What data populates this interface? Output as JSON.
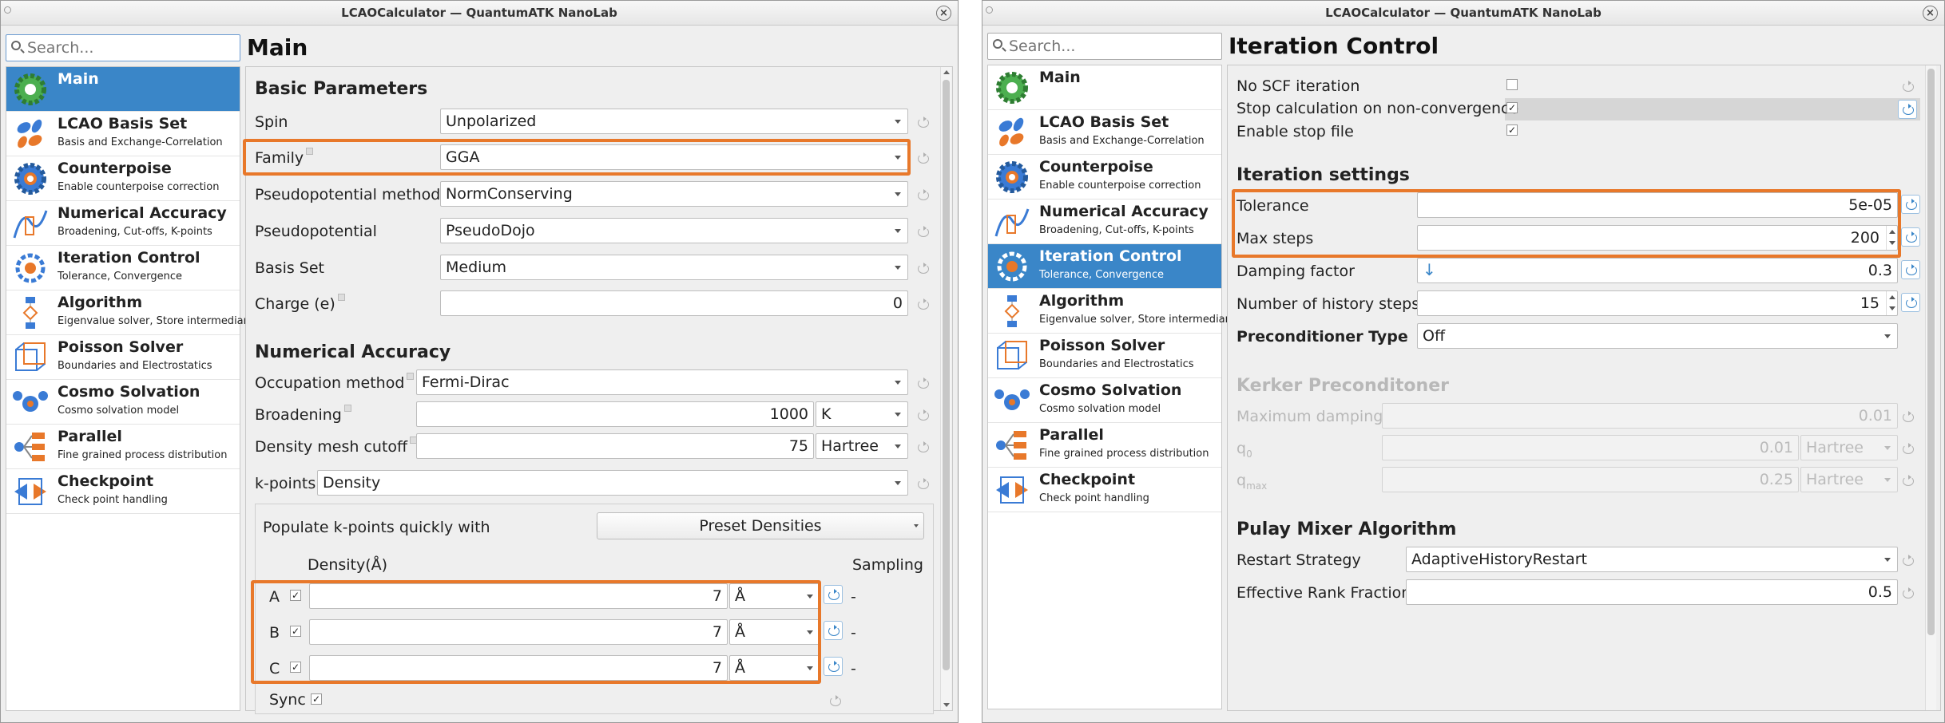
{
  "left": {
    "title": "LCAOCalculator — QuantumATK NanoLab",
    "search_placeholder": "Search...",
    "page_title": "Main",
    "sidebar": [
      {
        "title": "Main",
        "sub": "",
        "icon": "gear-green-icon"
      },
      {
        "title": "LCAO Basis Set",
        "sub": "Basis and Exchange-Correlation",
        "icon": "orbital-icon"
      },
      {
        "title": "Counterpoise",
        "sub": "Enable counterpoise correction",
        "icon": "gear-orange-icon"
      },
      {
        "title": "Numerical Accuracy",
        "sub": "Broadening, Cut-offs, K-points",
        "icon": "graph-icon"
      },
      {
        "title": "Iteration Control",
        "sub": "Tolerance, Convergence",
        "icon": "cycle-icon"
      },
      {
        "title": "Algorithm",
        "sub": "Eigenvalue solver, Store intermediaries",
        "icon": "flowchart-icon"
      },
      {
        "title": "Poisson Solver",
        "sub": "Boundaries and Electrostatics",
        "icon": "cube-icon"
      },
      {
        "title": "Cosmo Solvation",
        "sub": "Cosmo solvation model",
        "icon": "molecule-icon"
      },
      {
        "title": "Parallel",
        "sub": "Fine grained process distribution",
        "icon": "parallel-icon"
      },
      {
        "title": "Checkpoint",
        "sub": "Check point handling",
        "icon": "checkpoint-icon"
      }
    ],
    "basic": {
      "heading": "Basic Parameters",
      "spin_label": "Spin",
      "spin_value": "Unpolarized",
      "family_label": "Family",
      "family_value": "GGA",
      "pp_method_label": "Pseudopotential method",
      "pp_method_value": "NormConserving",
      "pp_label": "Pseudopotential",
      "pp_value": "PseudoDojo",
      "basis_label": "Basis Set",
      "basis_value": "Medium",
      "charge_label": "Charge (e)",
      "charge_value": "0"
    },
    "numerical": {
      "heading": "Numerical Accuracy",
      "occupation_label": "Occupation method",
      "occupation_value": "Fermi-Dirac",
      "broadening_label": "Broadening",
      "broadening_value": "1000",
      "broadening_unit": "K",
      "mesh_label": "Density mesh cutoff",
      "mesh_value": "75",
      "mesh_unit": "Hartree",
      "kpoints_label": "k-points",
      "kpoints_value": "Density",
      "populate_label": "Populate k-points quickly with",
      "preset_button": "Preset Densities",
      "density_header": "Density(Å)",
      "sampling_header": "Sampling",
      "rows": [
        {
          "axis": "A",
          "checked": true,
          "value": "7",
          "unit": "Å",
          "sampling": "-"
        },
        {
          "axis": "B",
          "checked": true,
          "value": "7",
          "unit": "Å",
          "sampling": "-"
        },
        {
          "axis": "C",
          "checked": true,
          "value": "7",
          "unit": "Å",
          "sampling": "-"
        }
      ],
      "sync_label": "Sync"
    }
  },
  "right": {
    "title": "LCAOCalculator — QuantumATK NanoLab",
    "search_placeholder": "Search...",
    "page_title": "Iteration Control",
    "checks": [
      {
        "label": "No SCF iteration",
        "checked": false
      },
      {
        "label": "Stop calculation on non-convergence",
        "checked": true
      },
      {
        "label": "Enable stop file",
        "checked": true
      }
    ],
    "iteration": {
      "heading": "Iteration settings",
      "tolerance_label": "Tolerance",
      "tolerance_value": "5e-05",
      "maxsteps_label": "Max steps",
      "maxsteps_value": "200",
      "damping_label": "Damping factor",
      "damping_value": "0.3",
      "history_label": "Number of history steps",
      "history_value": "15",
      "precond_label": "Preconditioner Type",
      "precond_value": "Off"
    },
    "kerker": {
      "heading": "Kerker Preconditoner",
      "maxdamp_label": "Maximum damping",
      "maxdamp_value": "0.01",
      "q0_label": "q",
      "q0_sub": "0",
      "q0_value": "0.01",
      "q0_unit": "Hartree",
      "qmax_label": "q",
      "qmax_sub": "max",
      "qmax_value": "0.25",
      "qmax_unit": "Hartree"
    },
    "pulay": {
      "heading": "Pulay Mixer Algorithm",
      "restart_label": "Restart Strategy",
      "restart_value": "AdaptiveHistoryRestart",
      "rank_label": "Effective Rank Fraction",
      "rank_value": "0.5"
    }
  }
}
